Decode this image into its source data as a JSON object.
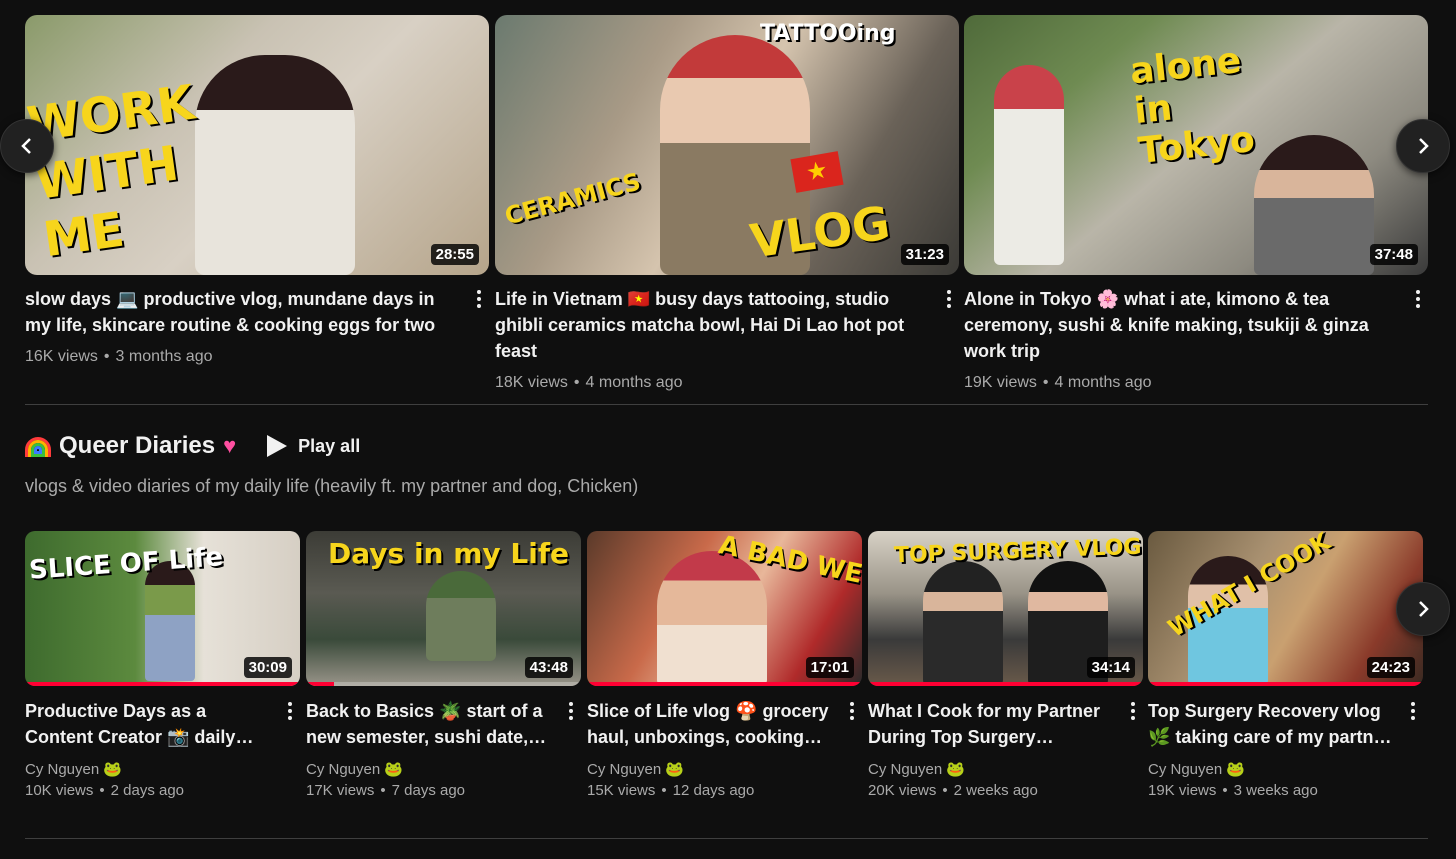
{
  "row1": [
    {
      "title": "slow days 💻 productive vlog, mundane days in my life, skincare routine & cooking eggs for two",
      "duration": "28:55",
      "views": "16K views",
      "age": "3 months ago",
      "overlay": "WORK WITH ME"
    },
    {
      "title": "Life in Vietnam 🇻🇳 busy days tattooing, studio ghibli ceramics matcha bowl, Hai Di Lao hot pot feast",
      "duration": "31:23",
      "views": "18K views",
      "age": "4 months ago",
      "overlay": "VLOG",
      "overlay2": "TATTOOing",
      "overlay3": "CERAMICS"
    },
    {
      "title": "Alone in Tokyo 🌸 what i ate, kimono & tea ceremony, sushi & knife making, tsukiji & ginza work trip",
      "duration": "37:48",
      "views": "19K views",
      "age": "4 months ago",
      "overlay": "alone in Tokyo"
    }
  ],
  "shelf": {
    "title": "Queer Diaries",
    "play_all": "Play all",
    "description": "vlogs & video diaries of my daily life (heavily ft. my partner and dog, Chicken)"
  },
  "row2": [
    {
      "title": "Productive Days as a Content Creator 📸 daily grind vlog, creating content, reading",
      "duration": "30:09",
      "channel": "Cy Nguyen 🐸",
      "views": "10K views",
      "age": "2 days ago",
      "overlay": "SLICE OF Life",
      "progress": 1.0
    },
    {
      "title": "Back to Basics 🪴 start of a new semester, sushi date, cleaning",
      "duration": "43:48",
      "channel": "Cy Nguyen 🐸",
      "views": "17K views",
      "age": "7 days ago",
      "overlay": "Days in my Life",
      "progress": 0.1
    },
    {
      "title": "Slice of Life vlog 🍄 grocery haul, unboxings, cooking dinner",
      "duration": "17:01",
      "channel": "Cy Nguyen 🐸",
      "views": "15K views",
      "age": "12 days ago",
      "overlay": "A BAD WEEK",
      "progress": 1.0
    },
    {
      "title": "What I Cook for my Partner During Top Surgery Recovery",
      "duration": "34:14",
      "channel": "Cy Nguyen 🐸",
      "views": "20K views",
      "age": "2 weeks ago",
      "overlay": "TOP SURGERY VLOG",
      "progress": 1.0
    },
    {
      "title": "Top Surgery Recovery vlog 🌿 taking care of my partner, cooking",
      "duration": "24:23",
      "channel": "Cy Nguyen 🐸",
      "views": "19K views",
      "age": "3 weeks ago",
      "overlay": "WHAT I COOK",
      "progress": 1.0
    }
  ],
  "icons": {
    "prev": "chevron-left-icon",
    "next": "chevron-right-icon",
    "more": "more-vertical-icon",
    "play": "play-icon"
  },
  "colors": {
    "background": "#0f0f0f",
    "progress": "#ff0033",
    "text_secondary": "#aaaaaa",
    "overlay_yellow": "#f7d51c"
  }
}
